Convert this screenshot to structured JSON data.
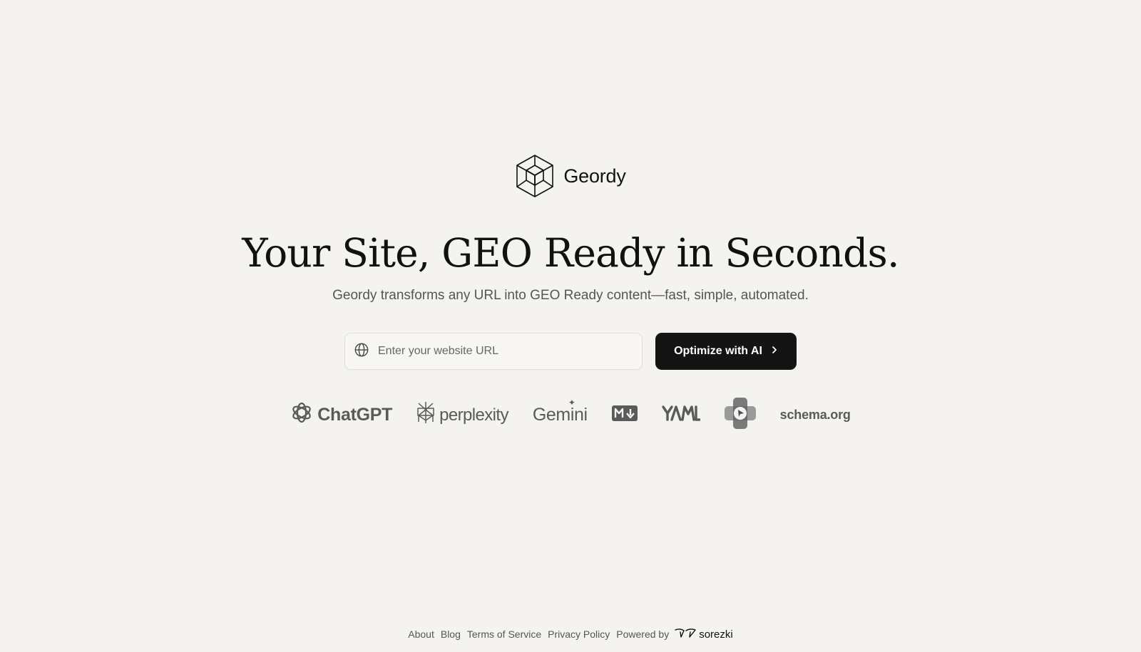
{
  "brand": {
    "name": "Geordy",
    "logo_icon": "geometric-cube-icon"
  },
  "hero": {
    "headline": "Your Site, GEO Ready in Seconds.",
    "subheadline": "Geordy transforms any URL into GEO Ready content—fast, simple, automated."
  },
  "form": {
    "url_icon": "globe-icon",
    "url_placeholder": "Enter your website URL",
    "url_value": "",
    "submit_label": "Optimize with AI",
    "submit_icon": "chevron-right-icon"
  },
  "logos": [
    {
      "name": "ChatGPT",
      "label": "ChatGPT",
      "icon": "openai-icon"
    },
    {
      "name": "Perplexity",
      "label": "perplexity",
      "icon": "perplexity-icon"
    },
    {
      "name": "Gemini",
      "label": "Gemini",
      "icon": "gemini-spark-icon"
    },
    {
      "name": "Markdown",
      "label": "",
      "icon": "markdown-icon"
    },
    {
      "name": "YAML",
      "label": "",
      "icon": "yaml-icon"
    },
    {
      "name": "Extension",
      "label": "",
      "icon": "plugin-icon"
    },
    {
      "name": "schema.org",
      "label": "schema.org",
      "icon": ""
    }
  ],
  "footer": {
    "links": [
      "About",
      "Blog",
      "Terms of Service",
      "Privacy Policy"
    ],
    "powered_by_label": "Powered by",
    "powered_by_brand": "sorezki",
    "powered_by_icon": "sorezki-logo-icon"
  },
  "colors": {
    "background": "#f4f3ef",
    "primary_button": "#141414",
    "logo_gray": "#5a5a5a",
    "muted_text": "#555555"
  }
}
